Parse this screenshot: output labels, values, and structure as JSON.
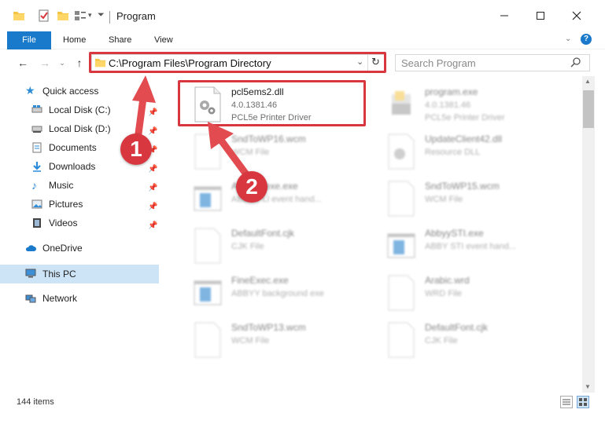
{
  "window": {
    "title": "Program",
    "controls": {
      "minimize": "minimize-icon",
      "maximize": "maximize-icon",
      "close": "close-icon"
    }
  },
  "ribbon": {
    "tabs": [
      {
        "label": "File",
        "active": true
      },
      {
        "label": "Home"
      },
      {
        "label": "Share"
      },
      {
        "label": "View"
      }
    ]
  },
  "address": {
    "path": "C:\\Program Files\\Program Directory",
    "search_placeholder": "Search Program"
  },
  "sidebar": {
    "quick_access": "Quick access",
    "items": [
      {
        "label": "Local Disk (C:)",
        "icon": "drive-icon"
      },
      {
        "label": "Local Disk (D:)",
        "icon": "drive-icon"
      },
      {
        "label": "Documents",
        "icon": "documents-icon"
      },
      {
        "label": "Downloads",
        "icon": "downloads-icon"
      },
      {
        "label": "Music",
        "icon": "music-icon"
      },
      {
        "label": "Pictures",
        "icon": "pictures-icon"
      },
      {
        "label": "Videos",
        "icon": "videos-icon"
      }
    ],
    "onedrive": "OneDrive",
    "this_pc": "This PC",
    "network": "Network"
  },
  "files": [
    {
      "name": "pcl5ems2.dll",
      "line2": "4.0.1381.46",
      "line3": "PCL5e Printer Driver",
      "icon": "dll-gear-icon"
    },
    {
      "name": "program.exe",
      "line2": "4.0.1381.46",
      "line3": "PCL5e Printer Driver",
      "icon": "exe-icon"
    },
    {
      "name": "SndToWP16.wcm",
      "line2": "WCM File",
      "line3": "",
      "icon": "file-icon"
    },
    {
      "name": "UpdateClient42.dll",
      "line2": "Resource DLL",
      "line3": "",
      "icon": "dll-icon"
    },
    {
      "name": "AbbyyLlexe.exe",
      "line2": "ABBYY Ll event hand...",
      "line3": "",
      "icon": "exe-window-icon"
    },
    {
      "name": "SndToWP15.wcm",
      "line2": "WCM File",
      "line3": "",
      "icon": "file-icon"
    },
    {
      "name": "DefaultFont.cjk",
      "line2": "CJK File",
      "line3": "",
      "icon": "file-icon"
    },
    {
      "name": "AbbyySTI.exe",
      "line2": "ABBY STI event hand...",
      "line3": "",
      "icon": "exe-window-icon"
    },
    {
      "name": "FineExec.exe",
      "line2": "ABBYY background exe",
      "line3": "",
      "icon": "exe-window-icon"
    },
    {
      "name": "Arabic.wrd",
      "line2": "WRD File",
      "line3": "",
      "icon": "file-icon"
    },
    {
      "name": "SndToWP13.wcm",
      "line2": "WCM File",
      "line3": "",
      "icon": "file-icon"
    },
    {
      "name": "DefaultFont.cjk",
      "line2": "CJK File",
      "line3": "",
      "icon": "file-icon"
    }
  ],
  "status": {
    "count": "144 items"
  },
  "callouts": [
    "1",
    "2"
  ],
  "colors": {
    "accent": "#1979ca",
    "highlight": "#d9373f",
    "selected": "#cde4f7"
  }
}
